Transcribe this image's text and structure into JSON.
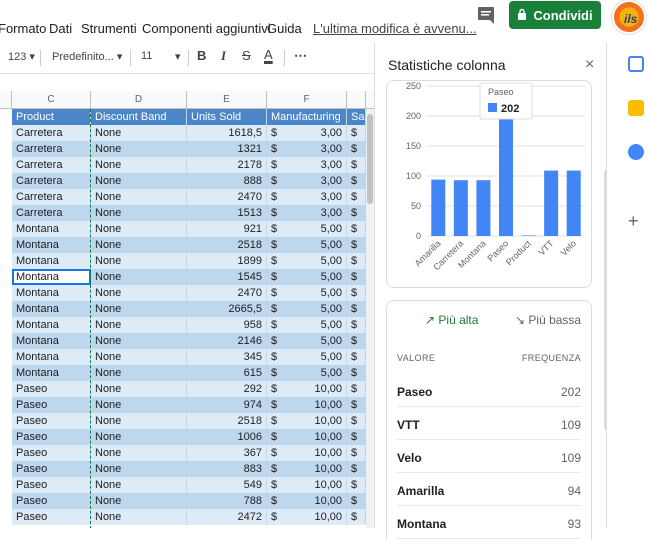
{
  "menubar": {
    "items": [
      "Formato",
      "Dati",
      "Strumenti",
      "Componenti aggiuntivi",
      "Guida",
      "L'ultima modifica è avvenu..."
    ],
    "share_label": "Condividi",
    "comment_icon": "comment-icon",
    "avatar_text": "ils"
  },
  "toolbar": {
    "format_label": "123",
    "font_label": "Predefinito...",
    "size_label": "11",
    "bold": "B",
    "italic": "I",
    "strike": "S",
    "text_color": "A",
    "more": "⋯"
  },
  "grid": {
    "columns": [
      "C",
      "D",
      "E",
      "F"
    ],
    "header": [
      "Product",
      "Discount Band",
      "Units Sold",
      "Manufacturing",
      "Sal"
    ],
    "rows": [
      [
        "Carretera",
        "None",
        "1618,5",
        "3,00"
      ],
      [
        "Carretera",
        "None",
        "1321",
        "3,00"
      ],
      [
        "Carretera",
        "None",
        "2178",
        "3,00"
      ],
      [
        "Carretera",
        "None",
        "888",
        "3,00"
      ],
      [
        "Carretera",
        "None",
        "2470",
        "3,00"
      ],
      [
        "Carretera",
        "None",
        "1513",
        "3,00"
      ],
      [
        "Montana",
        "None",
        "921",
        "5,00"
      ],
      [
        "Montana",
        "None",
        "2518",
        "5,00"
      ],
      [
        "Montana",
        "None",
        "1899",
        "5,00"
      ],
      [
        "Montana",
        "None",
        "1545",
        "5,00"
      ],
      [
        "Montana",
        "None",
        "2470",
        "5,00"
      ],
      [
        "Montana",
        "None",
        "2665,5",
        "5,00"
      ],
      [
        "Montana",
        "None",
        "958",
        "5,00"
      ],
      [
        "Montana",
        "None",
        "2146",
        "5,00"
      ],
      [
        "Montana",
        "None",
        "345",
        "5,00"
      ],
      [
        "Montana",
        "None",
        "615",
        "5,00"
      ],
      [
        "Paseo",
        "None",
        "292",
        "10,00"
      ],
      [
        "Paseo",
        "None",
        "974",
        "10,00"
      ],
      [
        "Paseo",
        "None",
        "2518",
        "10,00"
      ],
      [
        "Paseo",
        "None",
        "1006",
        "10,00"
      ],
      [
        "Paseo",
        "None",
        "367",
        "10,00"
      ],
      [
        "Paseo",
        "None",
        "883",
        "10,00"
      ],
      [
        "Paseo",
        "None",
        "549",
        "10,00"
      ],
      [
        "Paseo",
        "None",
        "788",
        "10,00"
      ],
      [
        "Paseo",
        "None",
        "2472",
        "10,00"
      ]
    ],
    "currency": "$"
  },
  "panel": {
    "title": "Statistiche colonna",
    "close": "×",
    "tooltip_label": "Paseo",
    "tooltip_value": "202",
    "tab_high": "Più alta",
    "tab_low": "Più bassa",
    "col_value": "VALORE",
    "col_freq": "FREQUENZA",
    "freq": [
      {
        "value": "Paseo",
        "count": "202"
      },
      {
        "value": "VTT",
        "count": "109"
      },
      {
        "value": "Velo",
        "count": "109"
      },
      {
        "value": "Amarilla",
        "count": "94"
      },
      {
        "value": "Montana",
        "count": "93"
      }
    ]
  },
  "chart_data": {
    "type": "bar",
    "categories": [
      "Amarilla",
      "Carretera",
      "Montana",
      "Paseo",
      "Product",
      "VTT",
      "Velo"
    ],
    "values": [
      94,
      93,
      93,
      202,
      1,
      109,
      109
    ],
    "yticks": [
      0,
      50,
      100,
      150,
      200,
      250
    ],
    "ylim": [
      0,
      250
    ],
    "color": "#4285f4"
  }
}
